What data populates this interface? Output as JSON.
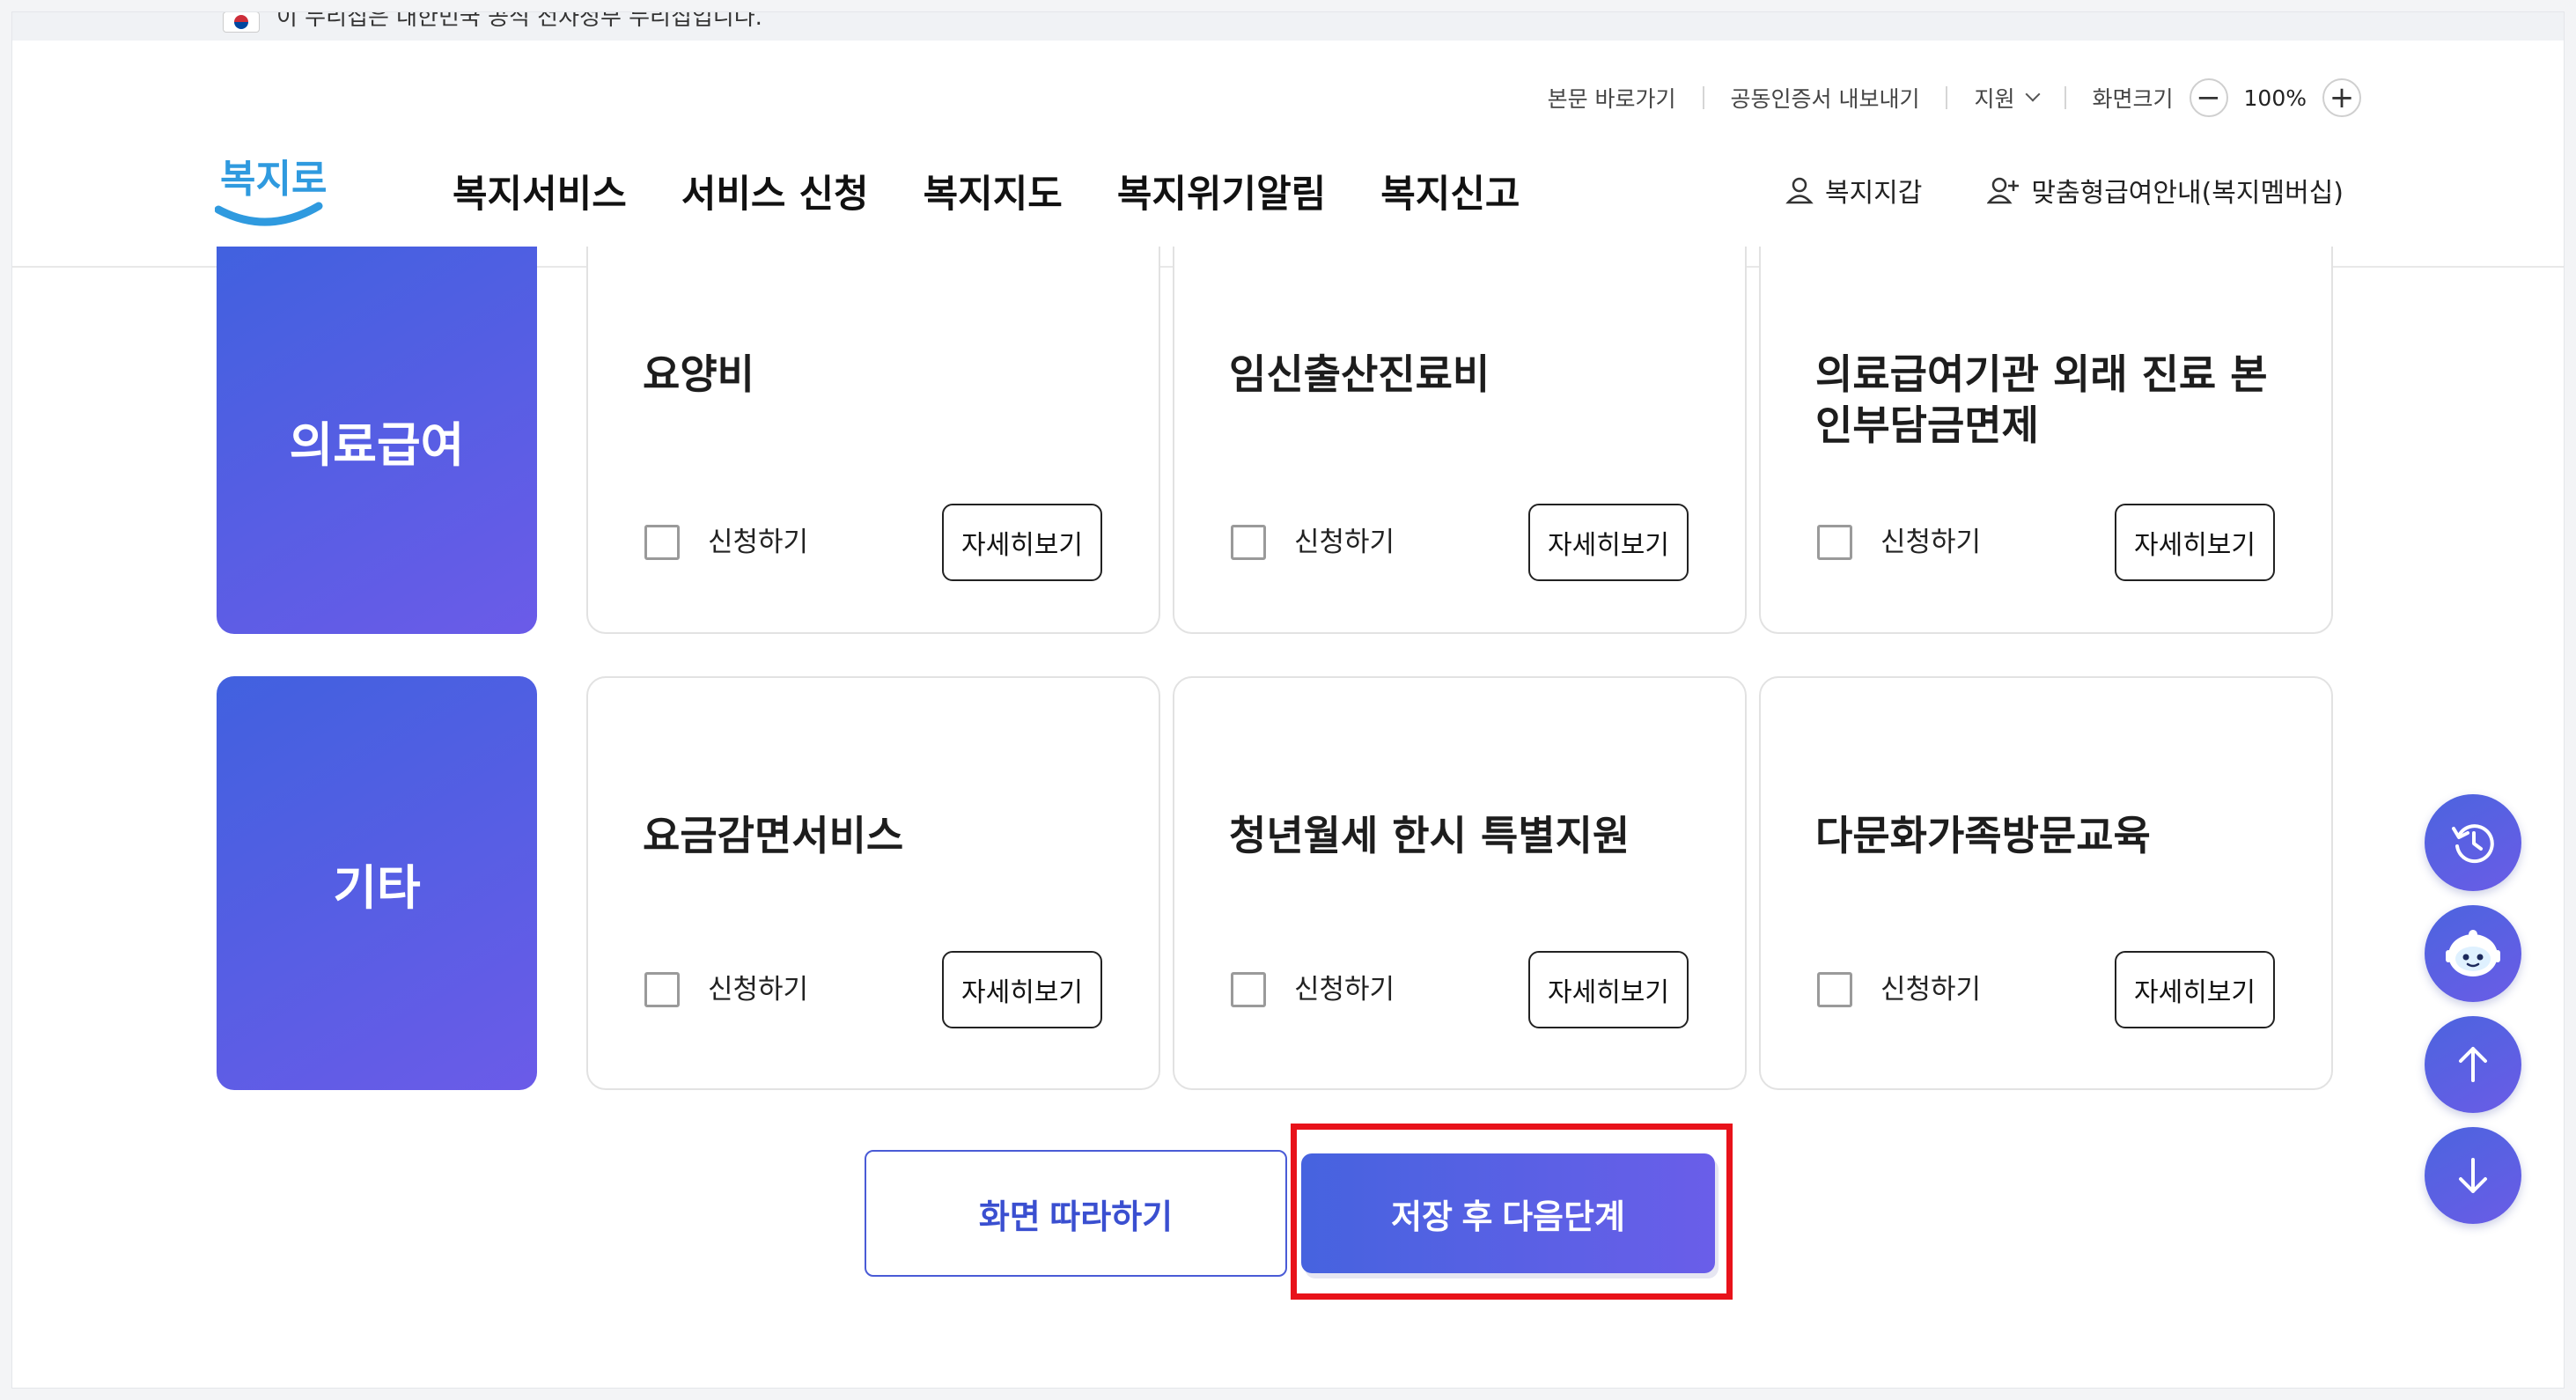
{
  "banner": {
    "text": "이 누리집은 대한민국 공식 전자정부 누리집입니다."
  },
  "util": {
    "skip": "본문 바로가기",
    "cert_export": "공동인증서 내보내기",
    "support": "지원",
    "zoom_label": "화면크기",
    "zoom_minus": "−",
    "zoom_value": "100%",
    "zoom_plus": "+"
  },
  "logo": {
    "text": "복지로"
  },
  "gnb": [
    "복지서비스",
    "서비스 신청",
    "복지지도",
    "복지위기알림",
    "복지신고"
  ],
  "member": {
    "wallet": "복지지갑",
    "custom": "맞춤형급여안내(복지멤버십)"
  },
  "rows": [
    {
      "category": "의료급여",
      "cards": [
        {
          "title": "요양비",
          "check_label": "신청하기",
          "detail_label": "자세히보기"
        },
        {
          "title": "임신출산진료비",
          "check_label": "신청하기",
          "detail_label": "자세히보기"
        },
        {
          "title": "의료급여기관 외래 진료 본인부담금면제",
          "check_label": "신청하기",
          "detail_label": "자세히보기"
        }
      ]
    },
    {
      "category": "기타",
      "cards": [
        {
          "title": "요금감면서비스",
          "check_label": "신청하기",
          "detail_label": "자세히보기"
        },
        {
          "title": "청년월세 한시 특별지원",
          "check_label": "신청하기",
          "detail_label": "자세히보기"
        },
        {
          "title": "다문화가족방문교육",
          "check_label": "신청하기",
          "detail_label": "자세히보기"
        }
      ]
    }
  ],
  "actions": {
    "follow": "화면 따라하기",
    "next": "저장 후 다음단계"
  },
  "floating": [
    "history-icon",
    "chatbot-icon",
    "arrow-up-icon",
    "arrow-down-icon"
  ],
  "colors": {
    "accent": "#4a5bd6",
    "highlight": "#e8121a"
  }
}
